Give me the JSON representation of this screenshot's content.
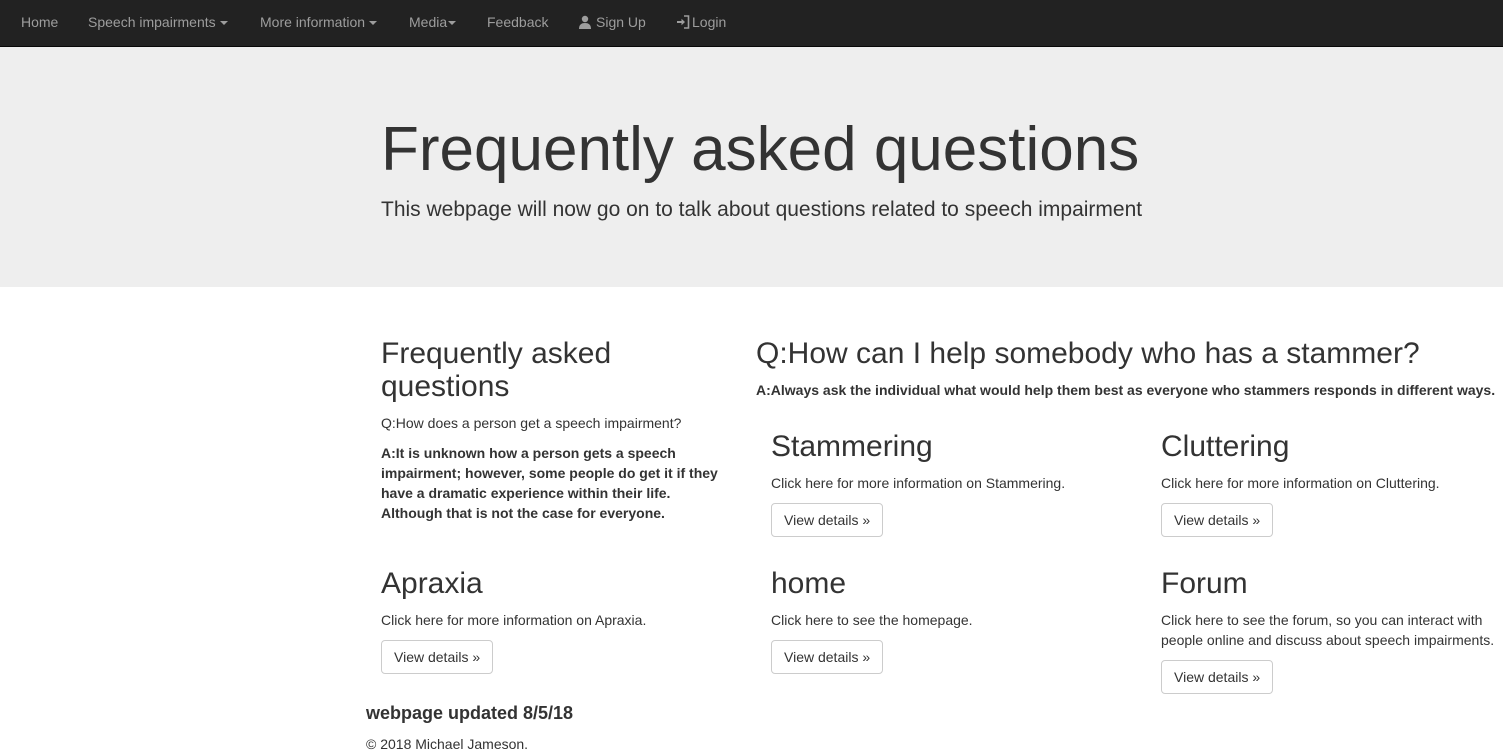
{
  "nav": {
    "home": "Home",
    "speech_impairments": "Speech impairments",
    "more_information": "More information",
    "media": "Media",
    "feedback": "Feedback",
    "sign_up": "Sign Up",
    "login": "Login"
  },
  "jumbotron": {
    "title": "Frequently asked questions",
    "lead": "This webpage will now go on to talk about questions related to speech impairment"
  },
  "faq_left": {
    "heading": "Frequently asked questions",
    "question": "Q:How does a person get a speech impairment?",
    "answer": "A:It is unknown how a person gets a speech impairment; however, some people do get it if they have a dramatic experience within their life. Although that is not the case for everyone."
  },
  "faq_right": {
    "heading": "Q:How can I help somebody who has a stammer?",
    "answer": "A:Always ask the individual what would help them best as everyone who stammers responds in different ways."
  },
  "cards": {
    "stammering": {
      "title": "Stammering",
      "text": "Click here for more information on Stammering.",
      "button": "View details »"
    },
    "cluttering": {
      "title": "Cluttering",
      "text": "Click here for more information on Cluttering.",
      "button": "View details »"
    },
    "apraxia": {
      "title": "Apraxia",
      "text": "Click here for more information on Apraxia.",
      "button": "View details »"
    },
    "home": {
      "title": "home",
      "text": "Click here to see the homepage.",
      "button": "View details »"
    },
    "forum": {
      "title": "Forum",
      "text": "Click here to see the forum, so you can interact with people online and discuss about speech impairments.",
      "button": "View details »"
    }
  },
  "footer": {
    "updated": "webpage updated 8/5/18",
    "copyright": "© 2018 Michael Jameson."
  },
  "colors": {
    "navbar_bg": "#222222",
    "nav_text": "#9d9d9d",
    "jumbotron_bg": "#eeeeee",
    "text": "#333333"
  }
}
